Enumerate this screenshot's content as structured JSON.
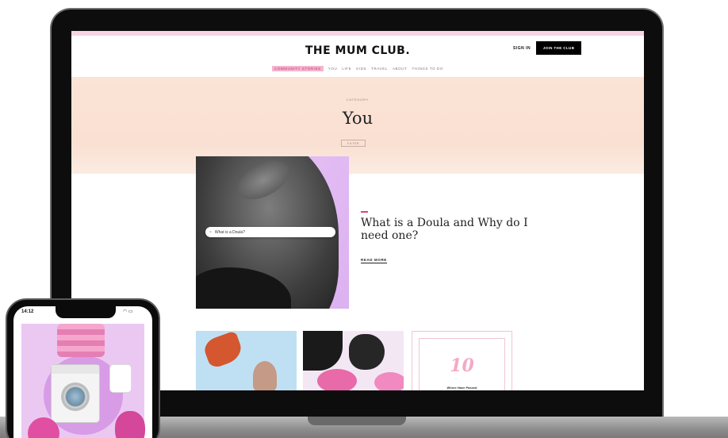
{
  "site": {
    "logo": "THE MUM CLUB.",
    "sign_in": "SIGN IN",
    "join_button": "JOIN THE CLUB"
  },
  "nav": {
    "items": [
      "COMMUNITY STORIES",
      "YOU",
      "LIFE",
      "KIDS",
      "TRAVEL",
      "ABOUT",
      "THINGS TO DO"
    ],
    "active_index": 0
  },
  "hero": {
    "breadcrumb": "CATEGORY",
    "title": "You",
    "filter_label": "FILTER"
  },
  "feature": {
    "search_text": "What is a Doula?",
    "title": "What is a Doula and Why do I need one?",
    "read_more": "READ MORE"
  },
  "tiles": {
    "number_tile_value": "10",
    "number_tile_caption": "Where Have Passed"
  },
  "phone": {
    "time": "14:12",
    "status_icons": "wifi-icon battery-icon"
  },
  "colors": {
    "accent_pink": "#e0407e",
    "hero_background": "#fbe3d6",
    "join_button_bg": "#000000"
  }
}
